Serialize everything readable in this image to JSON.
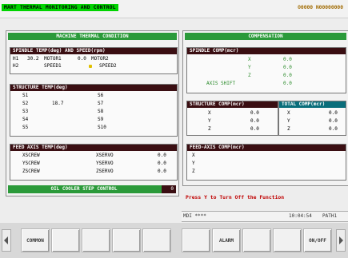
{
  "title_bar": {
    "title": "MART THERMAL MONITORING AND CONTROL",
    "codes": "O0000 N00000000"
  },
  "left_panel": {
    "header": "MACHINE THERMAL CONDITION",
    "spindle": {
      "header": "SPINDLE TEMP(deg) AND SPEED(rpm)",
      "row1": {
        "c1": "H1",
        "c2": "30.2",
        "c3": "MOTOR1",
        "c4": "0.0",
        "c5": "MOTOR2"
      },
      "row2": {
        "c1": "H2",
        "c3": "SPEED1",
        "c5": "SPEED2"
      }
    },
    "structure": {
      "header": "STRUCTURE TEMP(deg)",
      "left": [
        "S1",
        "S2",
        "S3",
        "S4",
        "S5"
      ],
      "s2_value": "18.7",
      "right": [
        "S6",
        "S7",
        "S8",
        "S9",
        "S10"
      ]
    },
    "feed": {
      "header": "FEED AXIS TEMP(deg)",
      "rows": [
        {
          "a": "XSCREW",
          "b": "XSERVO",
          "v": "0.0"
        },
        {
          "a": "YSCREW",
          "b": "YSERVO",
          "v": "0.0"
        },
        {
          "a": "ZSCREW",
          "b": "ZSERVO",
          "v": "0.0"
        }
      ]
    },
    "oil": {
      "label": "OIL COOLER STEP CONTROL",
      "value": "0"
    }
  },
  "right_panel": {
    "header": "COMPENSATION",
    "spindle_comp": {
      "header": "SPINDLE COMP(mcr)",
      "rows": [
        {
          "k": "X",
          "v": "0.0"
        },
        {
          "k": "Y",
          "v": "0.0"
        },
        {
          "k": "Z",
          "v": "0.0"
        },
        {
          "k": "AXIS SHIFT",
          "v": "0.0"
        }
      ]
    },
    "structure_comp": {
      "header": "STRUCTURE COMP(mcr)",
      "rows": [
        {
          "k": "X",
          "v": "0.0"
        },
        {
          "k": "Y",
          "v": "0.0"
        },
        {
          "k": "Z",
          "v": "0.0"
        }
      ]
    },
    "total_comp": {
      "header": "TOTAL COMP(mcr)",
      "rows": [
        {
          "k": "X",
          "v": "0.0"
        },
        {
          "k": "Y",
          "v": "0.0"
        },
        {
          "k": "Z",
          "v": "0.0"
        }
      ]
    },
    "feed_comp": {
      "header": "FEED-AXIS COMP(mcr)",
      "rows": [
        "X",
        "Y",
        "Z"
      ]
    },
    "message": "Press Y to Turn Off the Function"
  },
  "status": {
    "mode": "MDI ****",
    "time": "10:04:54",
    "path": "PATH1"
  },
  "softkeys": [
    "COMMON",
    "",
    "",
    "",
    "",
    "",
    "ALARM",
    "",
    "",
    "ON/OFF"
  ]
}
